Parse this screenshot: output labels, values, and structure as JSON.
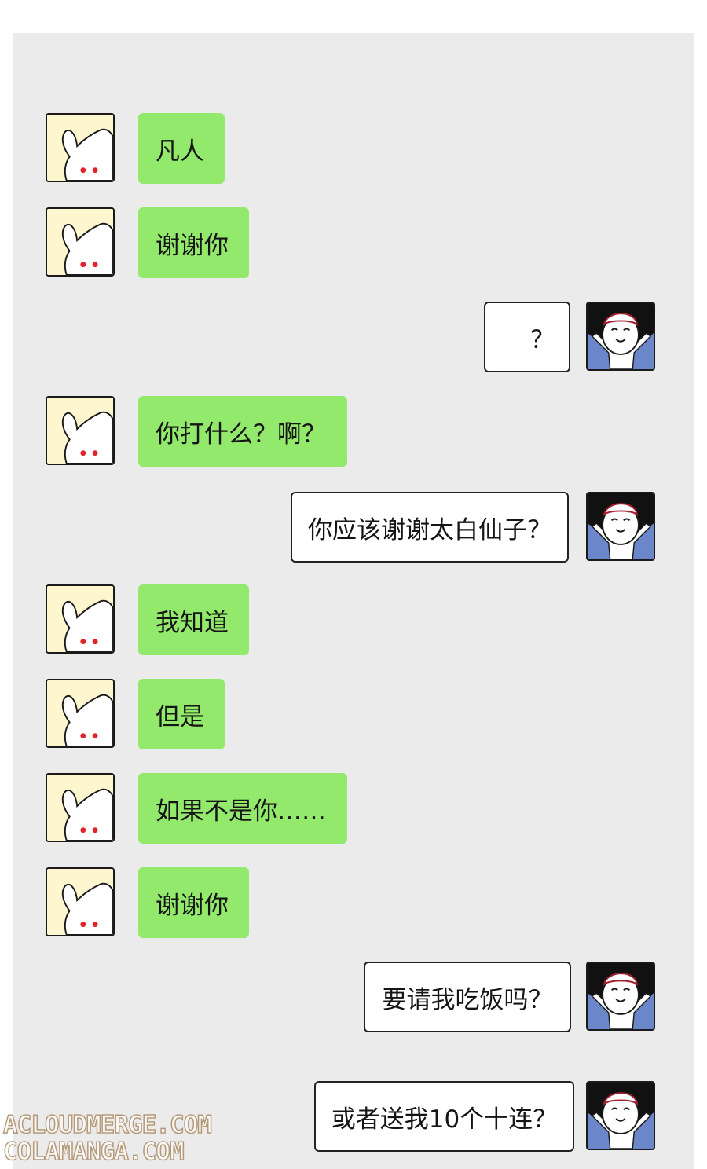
{
  "chat": {
    "messages": [
      {
        "sender": "rabbit",
        "text": "凡人"
      },
      {
        "sender": "rabbit",
        "text": "谢谢你"
      },
      {
        "sender": "me",
        "text": "？"
      },
      {
        "sender": "rabbit",
        "text": "你打什么？啊？"
      },
      {
        "sender": "me",
        "text": "你应该谢谢太白仙子？"
      },
      {
        "sender": "rabbit",
        "text": "我知道"
      },
      {
        "sender": "rabbit",
        "text": "但是"
      },
      {
        "sender": "rabbit",
        "text": "如果不是你……"
      },
      {
        "sender": "rabbit",
        "text": "谢谢你"
      },
      {
        "sender": "me",
        "text": "要请我吃饭吗？"
      },
      {
        "sender": "me",
        "text": "或者送我10个十连？"
      }
    ]
  },
  "watermark": {
    "line1": "ACLOUDMERGE.COM",
    "line2": "COLAMANGA.COM"
  },
  "avatars": {
    "rabbit_icon": "white-rabbit-icon",
    "me_icon": "smiling-person-icon"
  },
  "colors": {
    "background": "#ebebeb",
    "rabbit_bubble": "#93e96b",
    "me_bubble": "#ffffff",
    "rabbit_avatar_bg": "#fdf6cf",
    "rabbit_eyes": "#e0242a",
    "me_avatar_bg": "#111111",
    "me_avatar_shirt": "#6b86c9"
  }
}
